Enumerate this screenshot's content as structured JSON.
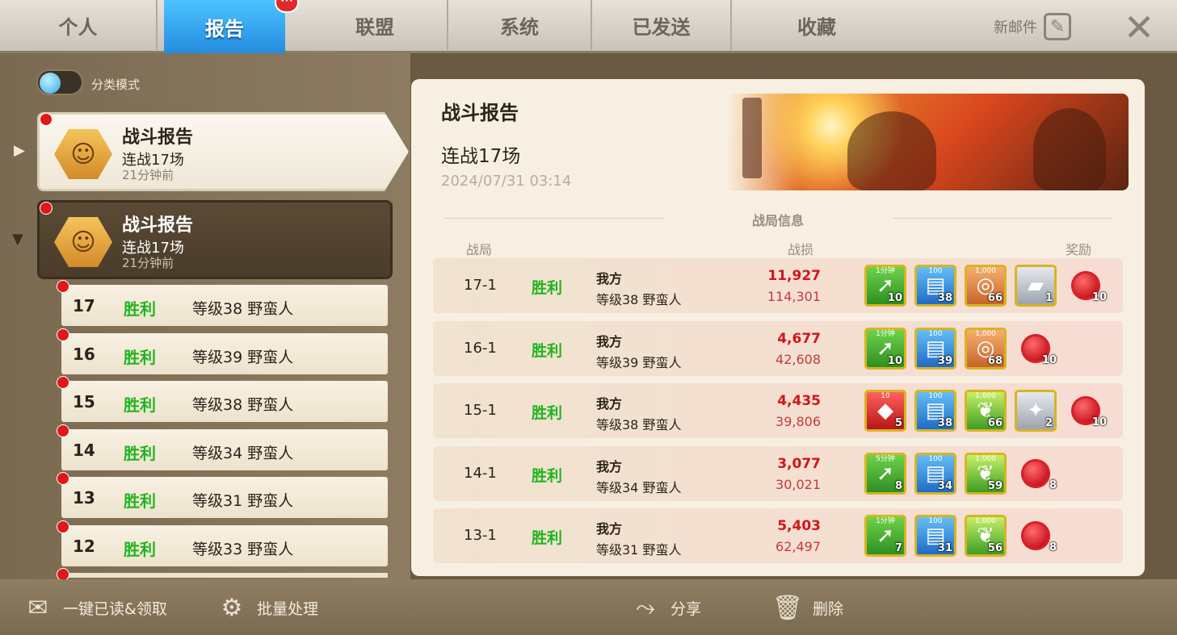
{
  "tabs": [
    {
      "label": "个人"
    },
    {
      "label": "报告"
    },
    {
      "label": "联盟"
    },
    {
      "label": "系统"
    },
    {
      "label": "已发送"
    },
    {
      "label": "收藏"
    }
  ],
  "tab_badge": "···",
  "new_mail_label": "新邮件",
  "close_icon": "close-icon",
  "toggle_label": "分类模式",
  "report_cards": [
    {
      "title": "战斗报告",
      "subtitle": "连战17场",
      "time": "21分钟前"
    },
    {
      "title": "战斗报告",
      "subtitle": "连战17场",
      "time": "21分钟前"
    }
  ],
  "battles": [
    {
      "num": "17",
      "result": "胜利",
      "level": "等级38 野蛮人"
    },
    {
      "num": "16",
      "result": "胜利",
      "level": "等级39 野蛮人"
    },
    {
      "num": "15",
      "result": "胜利",
      "level": "等级38 野蛮人"
    },
    {
      "num": "14",
      "result": "胜利",
      "level": "等级34 野蛮人"
    },
    {
      "num": "13",
      "result": "胜利",
      "level": "等级31 野蛮人"
    },
    {
      "num": "12",
      "result": "胜利",
      "level": "等级33 野蛮人"
    }
  ],
  "detail": {
    "title": "战斗报告",
    "subtitle": "连战17场",
    "date": "2024/07/31 03:14",
    "section_title": "战局信息",
    "col_round": "战局",
    "col_loss": "战损",
    "col_reward": "奖励"
  },
  "rounds": [
    {
      "round": "17-1",
      "result": "胜利",
      "side1": "我方",
      "side2": "等级38 野蛮人",
      "loss1": "11,927",
      "loss2": "114,301",
      "rewards": [
        {
          "kind": "it-green",
          "top": "1分钟",
          "count": "10",
          "icon": "speedup-icon"
        },
        {
          "kind": "it-blue",
          "top": "100",
          "count": "38",
          "icon": "tome-icon"
        },
        {
          "kind": "it-orange",
          "top": "1,000",
          "count": "66",
          "icon": "wood-icon"
        },
        {
          "kind": "it-gray",
          "top": "",
          "count": "1",
          "icon": "material-icon"
        },
        {
          "kind": "seal",
          "top": "",
          "count": "10",
          "icon": "seal-icon"
        }
      ]
    },
    {
      "round": "16-1",
      "result": "胜利",
      "side1": "我方",
      "side2": "等级39 野蛮人",
      "loss1": "4,677",
      "loss2": "42,608",
      "rewards": [
        {
          "kind": "it-green",
          "top": "1分钟",
          "count": "10",
          "icon": "speedup-icon"
        },
        {
          "kind": "it-blue",
          "top": "100",
          "count": "39",
          "icon": "tome-icon"
        },
        {
          "kind": "it-orange",
          "top": "1,000",
          "count": "68",
          "icon": "wood-icon"
        },
        {
          "kind": "seal",
          "top": "",
          "count": "10",
          "icon": "seal-icon"
        }
      ]
    },
    {
      "round": "15-1",
      "result": "胜利",
      "side1": "我方",
      "side2": "等级38 野蛮人",
      "loss1": "4,435",
      "loss2": "39,806",
      "rewards": [
        {
          "kind": "it-red",
          "top": "10",
          "count": "5",
          "icon": "gem-icon"
        },
        {
          "kind": "it-blue",
          "top": "100",
          "count": "38",
          "icon": "tome-icon"
        },
        {
          "kind": "it-corn",
          "top": "1,000",
          "count": "66",
          "icon": "food-icon"
        },
        {
          "kind": "it-gray",
          "top": "",
          "count": "2",
          "icon": "crystal-icon"
        },
        {
          "kind": "seal",
          "top": "",
          "count": "10",
          "icon": "seal-icon"
        }
      ]
    },
    {
      "round": "14-1",
      "result": "胜利",
      "side1": "我方",
      "side2": "等级34 野蛮人",
      "loss1": "3,077",
      "loss2": "30,021",
      "rewards": [
        {
          "kind": "it-green",
          "top": "5分钟",
          "count": "8",
          "icon": "speedup-icon"
        },
        {
          "kind": "it-blue",
          "top": "100",
          "count": "34",
          "icon": "tome-icon"
        },
        {
          "kind": "it-corn",
          "top": "1,000",
          "count": "59",
          "icon": "food-icon"
        },
        {
          "kind": "seal",
          "top": "",
          "count": "8",
          "icon": "seal-icon"
        }
      ]
    },
    {
      "round": "13-1",
      "result": "胜利",
      "side1": "我方",
      "side2": "等级31 野蛮人",
      "loss1": "5,403",
      "loss2": "62,497",
      "rewards": [
        {
          "kind": "it-green",
          "top": "1分钟",
          "count": "7",
          "icon": "speedup-icon"
        },
        {
          "kind": "it-blue",
          "top": "100",
          "count": "31",
          "icon": "tome-icon"
        },
        {
          "kind": "it-corn",
          "top": "1,000",
          "count": "56",
          "icon": "food-icon"
        },
        {
          "kind": "seal",
          "top": "",
          "count": "8",
          "icon": "seal-icon"
        }
      ]
    }
  ],
  "bottom": {
    "read_all": "一键已读&领取",
    "batch": "批量处理",
    "share": "分享",
    "delete": "删除"
  },
  "colors": {
    "accent_tab": "#1b7fd8",
    "win_green": "#1fb51f",
    "loss_red": "#d0161b"
  }
}
